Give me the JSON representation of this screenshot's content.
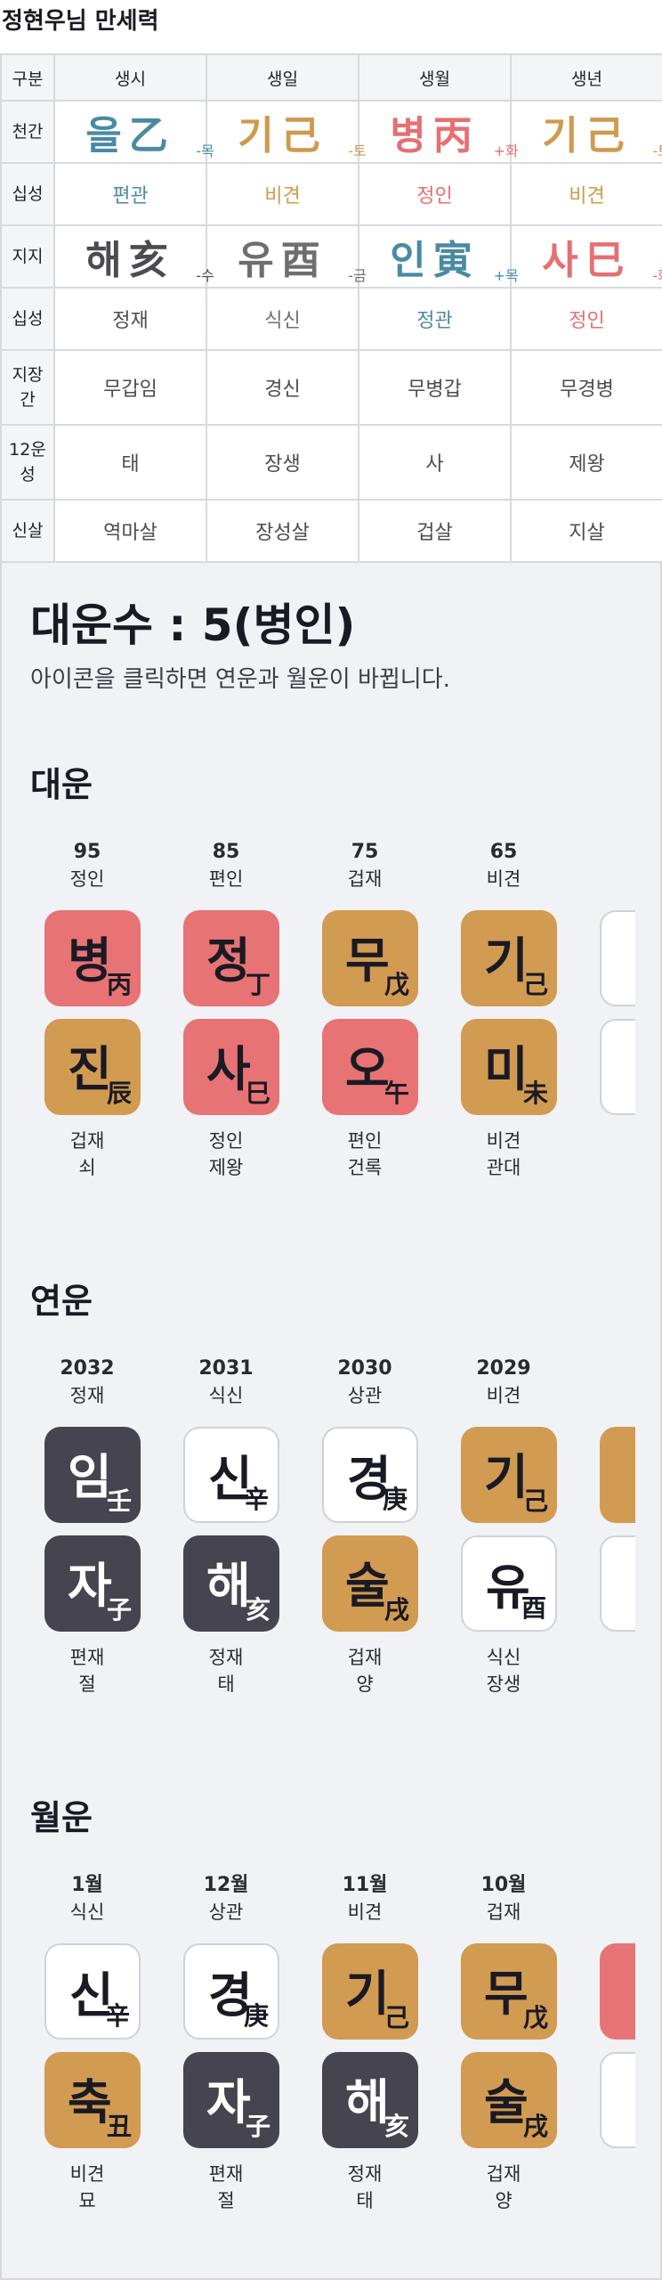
{
  "page_title": "정현우님 만세력",
  "table": {
    "header": [
      "구분",
      "생시",
      "생일",
      "생월",
      "생년"
    ],
    "rows": {
      "cheongan": {
        "label": "천간",
        "cells": [
          {
            "text": "을乙",
            "sub": "-목",
            "color": "#4a8aa3"
          },
          {
            "text": "기己",
            "sub": "-토",
            "color": "#cf9a4e"
          },
          {
            "text": "병丙",
            "sub": "+화",
            "color": "#e66f72"
          },
          {
            "text": "기己",
            "sub": "-토",
            "color": "#cf9a4e"
          }
        ]
      },
      "sipseong1": {
        "label": "십성",
        "cells": [
          "편관",
          "비견",
          "정인",
          "비견"
        ]
      },
      "jiji": {
        "label": "지지",
        "cells": [
          {
            "text": "해亥",
            "sub": "-수",
            "color": "#4b4b52"
          },
          {
            "text": "유酉",
            "sub": "-금",
            "color": "#6e6e72"
          },
          {
            "text": "인寅",
            "sub": "+목",
            "color": "#4a8aa3"
          },
          {
            "text": "사巳",
            "sub": "-화",
            "color": "#e66f72"
          }
        ]
      },
      "sipseong2": {
        "label": "십성",
        "cells": [
          "정재",
          "식신",
          "정관",
          "정인"
        ]
      },
      "jijanggan": {
        "label": "지장간",
        "cells": [
          "무갑임",
          "경신",
          "무병갑",
          "무경병"
        ]
      },
      "unseong": {
        "label": "12운성",
        "cells": [
          "태",
          "장생",
          "사",
          "제왕"
        ]
      },
      "sinsal": {
        "label": "신살",
        "cells": [
          "역마살",
          "장성살",
          "겁살",
          "지살"
        ]
      }
    }
  },
  "daeun_su": "대운수 : 5(병인)",
  "note": "아이콘을 클릭하면 연운과 월운이 바뀝니다.",
  "daeun": {
    "title": "대운",
    "items": [
      {
        "h1": "95",
        "h2": "정인",
        "top": {
          "big": "병",
          "small": "丙",
          "style": "red"
        },
        "bot": {
          "big": "진",
          "small": "辰",
          "style": "gold"
        },
        "f1": "겁재",
        "f2": "쇠"
      },
      {
        "h1": "85",
        "h2": "편인",
        "top": {
          "big": "정",
          "small": "丁",
          "style": "red"
        },
        "bot": {
          "big": "사",
          "small": "巳",
          "style": "red"
        },
        "f1": "정인",
        "f2": "제왕"
      },
      {
        "h1": "75",
        "h2": "겁재",
        "top": {
          "big": "무",
          "small": "戊",
          "style": "gold"
        },
        "bot": {
          "big": "오",
          "small": "午",
          "style": "red"
        },
        "f1": "편인",
        "f2": "건록"
      },
      {
        "h1": "65",
        "h2": "비견",
        "top": {
          "big": "기",
          "small": "己",
          "style": "gold"
        },
        "bot": {
          "big": "미",
          "small": "未",
          "style": "gold"
        },
        "f1": "비견",
        "f2": "관대"
      },
      {
        "h1": "",
        "h2": "",
        "top": {
          "big": "",
          "small": "",
          "style": "white"
        },
        "bot": {
          "big": "",
          "small": "",
          "style": "white"
        },
        "f1": "",
        "f2": ""
      }
    ]
  },
  "yeonun": {
    "title": "연운",
    "items": [
      {
        "h1": "2032",
        "h2": "정재",
        "top": {
          "big": "임",
          "small": "壬",
          "style": "dark"
        },
        "bot": {
          "big": "자",
          "small": "子",
          "style": "dark"
        },
        "f1": "편재",
        "f2": "절"
      },
      {
        "h1": "2031",
        "h2": "식신",
        "top": {
          "big": "신",
          "small": "辛",
          "style": "white"
        },
        "bot": {
          "big": "해",
          "small": "亥",
          "style": "dark"
        },
        "f1": "정재",
        "f2": "태"
      },
      {
        "h1": "2030",
        "h2": "상관",
        "top": {
          "big": "경",
          "small": "庚",
          "style": "white"
        },
        "bot": {
          "big": "술",
          "small": "戌",
          "style": "gold"
        },
        "f1": "겁재",
        "f2": "양"
      },
      {
        "h1": "2029",
        "h2": "비견",
        "top": {
          "big": "기",
          "small": "己",
          "style": "gold"
        },
        "bot": {
          "big": "유",
          "small": "酉",
          "style": "white"
        },
        "f1": "식신",
        "f2": "장생"
      },
      {
        "h1": "",
        "h2": "",
        "top": {
          "big": "",
          "small": "",
          "style": "gold"
        },
        "bot": {
          "big": "",
          "small": "",
          "style": "white"
        },
        "f1": "",
        "f2": ""
      }
    ]
  },
  "wolun": {
    "title": "월운",
    "items": [
      {
        "h1": "1월",
        "h2": "식신",
        "top": {
          "big": "신",
          "small": "辛",
          "style": "white"
        },
        "bot": {
          "big": "축",
          "small": "丑",
          "style": "gold"
        },
        "f1": "비견",
        "f2": "묘"
      },
      {
        "h1": "12월",
        "h2": "상관",
        "top": {
          "big": "경",
          "small": "庚",
          "style": "white"
        },
        "bot": {
          "big": "자",
          "small": "子",
          "style": "dark"
        },
        "f1": "편재",
        "f2": "절"
      },
      {
        "h1": "11월",
        "h2": "비견",
        "top": {
          "big": "기",
          "small": "己",
          "style": "gold"
        },
        "bot": {
          "big": "해",
          "small": "亥",
          "style": "dark"
        },
        "f1": "정재",
        "f2": "태"
      },
      {
        "h1": "10월",
        "h2": "겁재",
        "top": {
          "big": "무",
          "small": "戊",
          "style": "gold"
        },
        "bot": {
          "big": "술",
          "small": "戌",
          "style": "gold"
        },
        "f1": "겁재",
        "f2": "양"
      },
      {
        "h1": "",
        "h2": "",
        "top": {
          "big": "",
          "small": "",
          "style": "red"
        },
        "bot": {
          "big": "",
          "small": "",
          "style": "white"
        },
        "f1": "",
        "f2": ""
      }
    ]
  }
}
